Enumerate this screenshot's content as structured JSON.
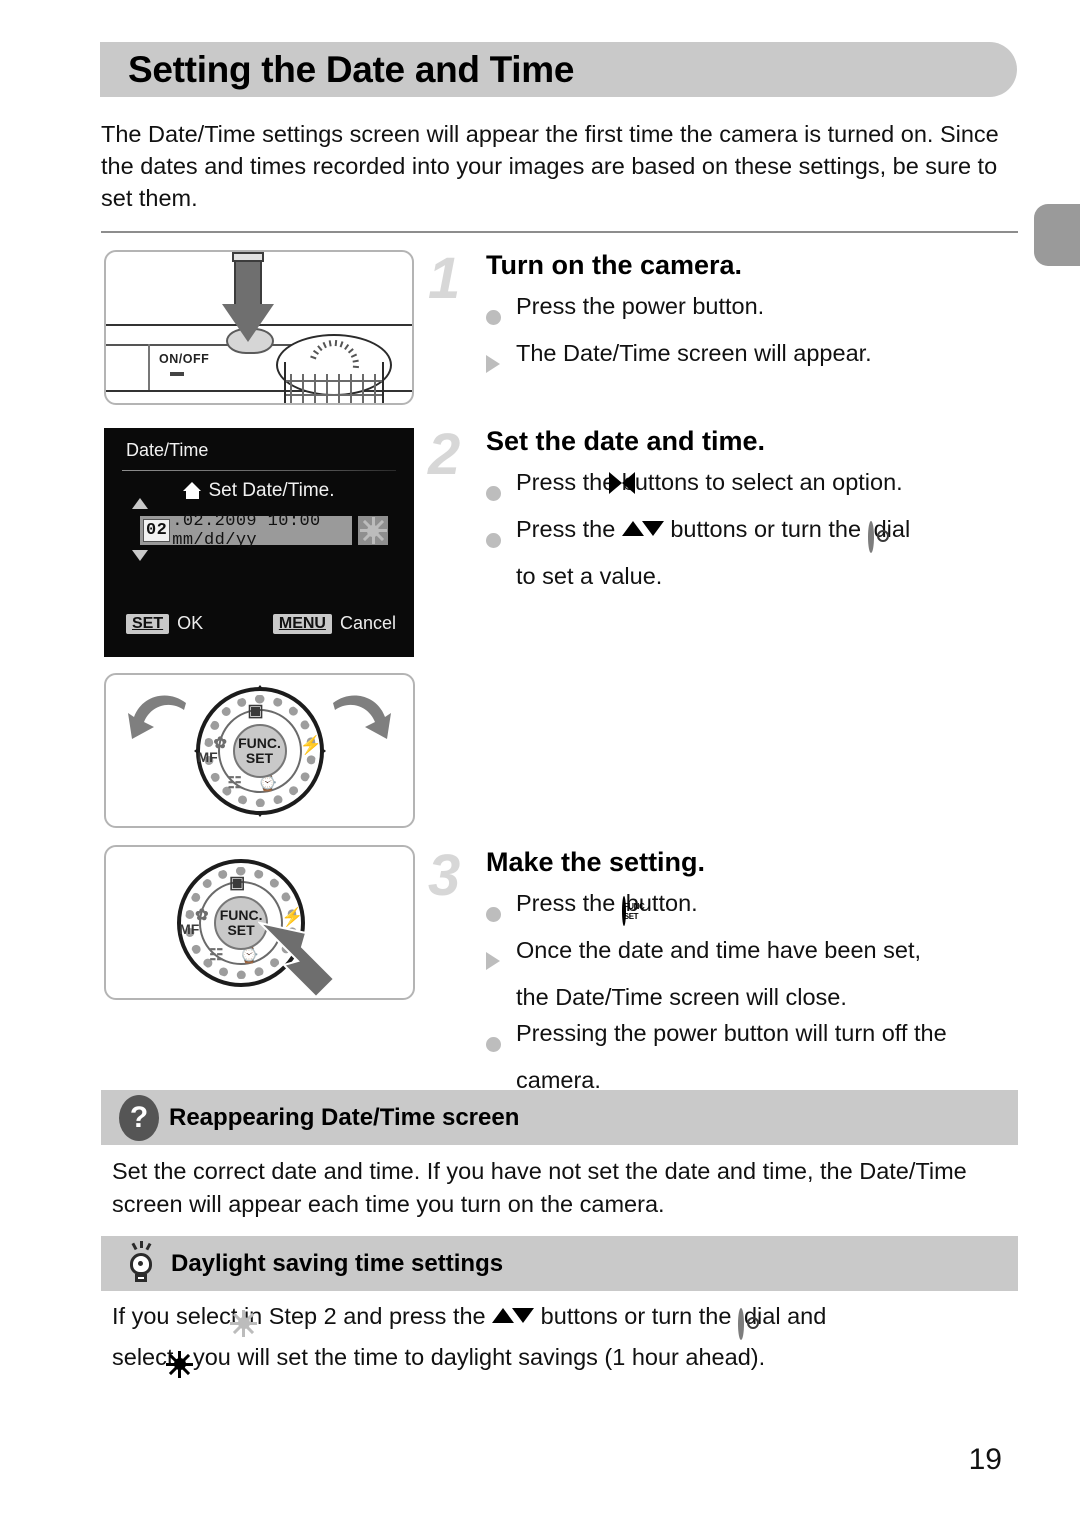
{
  "page": {
    "title": "Setting the Date and Time",
    "number": "19",
    "intro": "The Date/Time settings screen will appear the first time the camera is turned on. Since the dates and times recorded into your images are based on these settings, be sure to set them."
  },
  "steps": [
    {
      "number": "1",
      "heading": "Turn on the camera.",
      "lines": [
        {
          "marker": "dot",
          "text": "Press the power button."
        },
        {
          "marker": "triangle",
          "text": "The Date/Time screen will appear."
        }
      ]
    },
    {
      "number": "2",
      "heading": "Set the date and time.",
      "lines": [
        {
          "marker": "dot",
          "pre": "Press the ",
          "icon": "left-right-buttons-icon",
          "post": " buttons to select an option."
        },
        {
          "marker": "dot",
          "pre": "Press the ",
          "icon": "up-down-buttons-icon",
          "mid": " buttons or turn the ",
          "icon2": "control-dial-icon",
          "post": " dial",
          "cont": "to set a value."
        }
      ]
    },
    {
      "number": "3",
      "heading": "Make the setting.",
      "lines": [
        {
          "marker": "dot",
          "pre": "Press the ",
          "icon": "func-set-button-icon",
          "post": " button."
        },
        {
          "marker": "triangle",
          "text": "Once the date and time have been set,",
          "cont": "the Date/Time screen will close."
        },
        {
          "marker": "dot",
          "text": "Pressing the power button will turn off the",
          "cont": "camera."
        }
      ]
    }
  ],
  "figures": {
    "camera": {
      "label": "ON/OFF",
      "caption": "camera-top-power-button-illustration"
    },
    "lcd": {
      "screen_title": "Date/Time",
      "prompt": "Set Date/Time.",
      "value_highlight": "02",
      "value_rest": ".02.2009 10:00  mm/dd/yy",
      "set_key": "SET",
      "set_label": "OK",
      "menu_key": "MENU",
      "menu_label": "Cancel"
    },
    "dial": {
      "center_line1": "FUNC.",
      "center_line2": "SET",
      "label_mf": "MF",
      "caption": "control-dial-rotate-illustration"
    },
    "func": {
      "center_line1": "FUNC.",
      "center_line2": "SET",
      "label_mf": "MF",
      "caption": "func-set-press-illustration"
    }
  },
  "info_blocks": [
    {
      "icon": "question-mark-badge-icon",
      "title": "Reappearing Date/Time screen",
      "body": "Set the correct date and time. If you have not set the date and time, the Date/Time screen will appear each time you turn on the camera."
    },
    {
      "icon": "light-bulb-badge-icon",
      "title": "Daylight saving time settings",
      "body_pre": "If you select ",
      "body_mid": " in Step 2 and press the ",
      "body_mid2": " buttons or turn the ",
      "body_mid3": " dial and",
      "body_line2_pre": "select ",
      "body_line2_post": ", you will set the time to daylight savings (1 hour ahead)."
    }
  ],
  "colors": {
    "banner_gray": "#c9c9c9",
    "tab_gray": "#9a9a9a",
    "bullet_gray": "#bdbdbd",
    "step_number_gray": "#d7d7d7",
    "lcd_black": "#0a0a0a",
    "lcd_field_gray": "#9a9a9a"
  }
}
